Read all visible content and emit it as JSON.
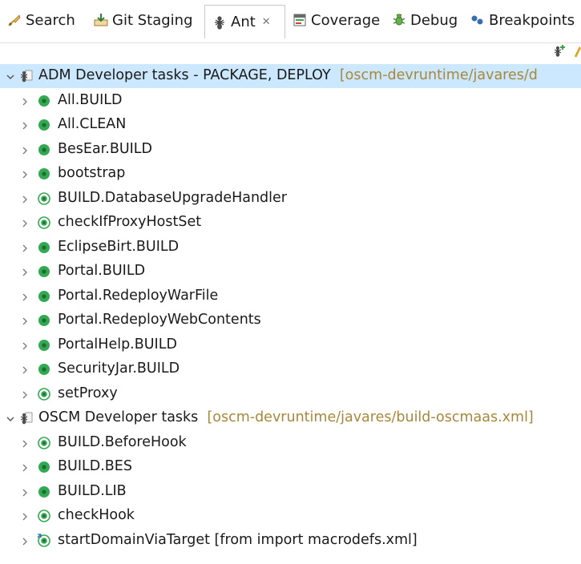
{
  "tabs": [
    {
      "label": "Search",
      "icon": "search-icon",
      "active": false
    },
    {
      "label": "Git Staging",
      "icon": "git-staging-icon",
      "active": false
    },
    {
      "label": "Ant",
      "icon": "ant-icon",
      "active": true
    },
    {
      "label": "Coverage",
      "icon": "coverage-icon",
      "active": false
    },
    {
      "label": "Debug",
      "icon": "debug-icon",
      "active": false
    },
    {
      "label": "Breakpoints",
      "icon": "breakpoints-icon",
      "active": false
    }
  ],
  "close_glyph": "✕",
  "tree": {
    "groups": [
      {
        "name": "ADM Developer tasks - PACKAGE, DEPLOY",
        "path": "[oscm-devruntime/javares/d",
        "selected": true,
        "targets": [
          {
            "label": "All.BUILD",
            "kind": "public"
          },
          {
            "label": "All.CLEAN",
            "kind": "public"
          },
          {
            "label": "BesEar.BUILD",
            "kind": "public"
          },
          {
            "label": "bootstrap",
            "kind": "public"
          },
          {
            "label": "BUILD.DatabaseUpgradeHandler",
            "kind": "internal"
          },
          {
            "label": "checkIfProxyHostSet",
            "kind": "internal"
          },
          {
            "label": "EclipseBirt.BUILD",
            "kind": "public"
          },
          {
            "label": "Portal.BUILD",
            "kind": "public"
          },
          {
            "label": "Portal.RedeployWarFile",
            "kind": "public"
          },
          {
            "label": "Portal.RedeployWebContents",
            "kind": "public"
          },
          {
            "label": "PortalHelp.BUILD",
            "kind": "public"
          },
          {
            "label": "SecurityJar.BUILD",
            "kind": "public"
          },
          {
            "label": "setProxy",
            "kind": "internal"
          }
        ]
      },
      {
        "name": "OSCM Developer tasks",
        "path": "[oscm-devruntime/javares/build-oscmaas.xml]",
        "selected": false,
        "targets": [
          {
            "label": "BUILD.BeforeHook",
            "kind": "internal"
          },
          {
            "label": "BUILD.BES",
            "kind": "public"
          },
          {
            "label": "BUILD.LIB",
            "kind": "public"
          },
          {
            "label": "checkHook",
            "kind": "internal"
          },
          {
            "label": "startDomainViaTarget [from import macrodefs.xml]",
            "kind": "imported"
          }
        ]
      }
    ]
  },
  "colors": {
    "selection": "#cce8ff",
    "target_green": "#2fa44f",
    "path_text": "#a8873a"
  }
}
